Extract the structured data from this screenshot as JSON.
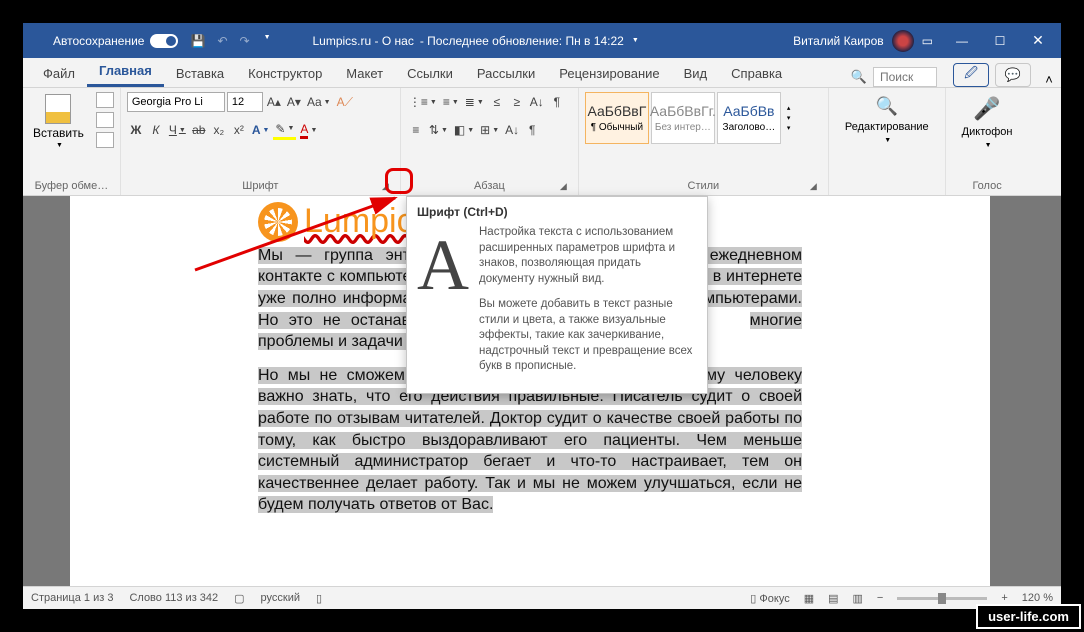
{
  "titlebar": {
    "autosave": "Автосохранение",
    "doc_title": "Lumpics.ru - О нас",
    "doc_sub": "- Последнее обновление: Пн в 14:22",
    "user": "Виталий Каиров"
  },
  "tabs": {
    "file": "Файл",
    "home": "Главная",
    "insert": "Вставка",
    "design": "Конструктор",
    "layout": "Макет",
    "references": "Ссылки",
    "mailings": "Рассылки",
    "review": "Рецензирование",
    "view": "Вид",
    "help": "Справка",
    "search_placeholder": "Поиск"
  },
  "ribbon": {
    "clipboard": {
      "paste": "Вставить",
      "label": "Буфер обме…"
    },
    "font": {
      "name": "Georgia Pro Li",
      "size": "12",
      "bold": "Ж",
      "italic": "К",
      "underline": "Ч",
      "strike": "ab",
      "sub": "x₂",
      "sup": "x²",
      "label": "Шрифт"
    },
    "paragraph": {
      "label": "Абзац"
    },
    "styles": {
      "label": "Стили",
      "prev": "АаБбВвГ",
      "prev2": "АаБбВвГг.",
      "prev3": "АаБбВв",
      "s1": "¶ Обычный",
      "s2": "Без интер…",
      "s3": "Заголово…"
    },
    "editing": {
      "label": "Редактирование"
    },
    "voice": {
      "label": "Диктофон",
      "btn": "Голос"
    }
  },
  "tooltip": {
    "title": "Шрифт (Ctrl+D)",
    "p1": "Настройка текста с использованием расширенных параметров шрифта и знаков, позволяющая придать документу нужный вид.",
    "p2": "Вы можете добавить в текст разные стили и цвета, а также визуальные эффекты, такие как зачеркивание, надстрочный текст и превращение всех букв в прописные."
  },
  "document": {
    "logo": "Lumpics.ru",
    "p1a": "Мы — группа энтузиас",
    "p1b": "м в ежедневном контакте с компьютерами и мобил",
    "p1c": "что в интернете уже полно информации о решен",
    "p1d": "омпьютерами. Но это не останавливает нас, что",
    "p1e": "многие проблемы и задачи более качественно и бы",
    "p2a": "Но мы не сможем это",
    "p2b": "и. Любому человеку важно знать, что его действия правильные. Писатель судит о своей работе по отзывам читателей. Доктор судит о качестве своей работы по тому, как быстро выздоравливают его пациенты. Чем меньше системный администратор бегает и что-то настраивает, тем он качественнее делает работу. Так и мы не можем улучшаться, если не будем получать ответов от Вас."
  },
  "statusbar": {
    "page": "Страница 1 из 3",
    "words": "Слово 113 из 342",
    "lang": "русский",
    "focus": "Фокус",
    "zoom": "120 %"
  },
  "watermark": "user-life.com"
}
